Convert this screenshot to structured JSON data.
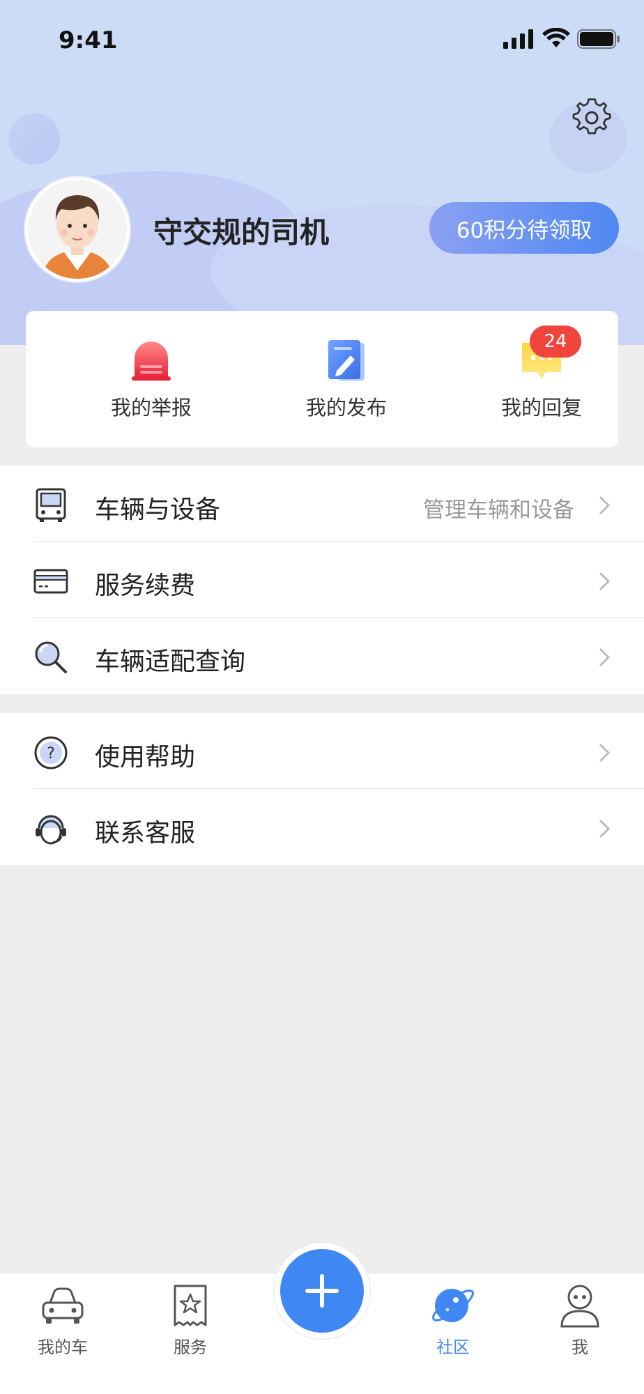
{
  "status_bar": {
    "time": "9:41"
  },
  "profile": {
    "username": "守交规的司机",
    "points_button": "60积分待领取"
  },
  "quick_actions": [
    {
      "label": "我的举报",
      "icon": "alarm-light-icon"
    },
    {
      "label": "我的发布",
      "icon": "edit-document-icon"
    },
    {
      "label": "我的回复",
      "icon": "chat-bubble-icon",
      "badge": "24"
    }
  ],
  "menu_group_1": [
    {
      "label": "车辆与设备",
      "hint": "管理车辆和设备",
      "icon": "bus-icon"
    },
    {
      "label": "服务续费",
      "hint": "",
      "icon": "card-icon"
    },
    {
      "label": "车辆适配查询",
      "hint": "",
      "icon": "magnifier-icon"
    }
  ],
  "menu_group_2": [
    {
      "label": "使用帮助",
      "icon": "help-icon"
    },
    {
      "label": "联系客服",
      "icon": "customer-service-icon"
    }
  ],
  "tabbar": {
    "tabs": [
      {
        "label": "我的车",
        "icon": "car-icon"
      },
      {
        "label": "服务",
        "icon": "service-ticket-icon"
      },
      {
        "label": "社区",
        "icon": "planet-icon",
        "active": true
      },
      {
        "label": "我",
        "icon": "user-icon"
      }
    ],
    "fab_icon": "plus-icon"
  },
  "colors": {
    "accent": "#3F87F2",
    "header_bg": "#CDDCF6",
    "badge": "#F0453C",
    "page_bg": "#EEEEEE"
  }
}
